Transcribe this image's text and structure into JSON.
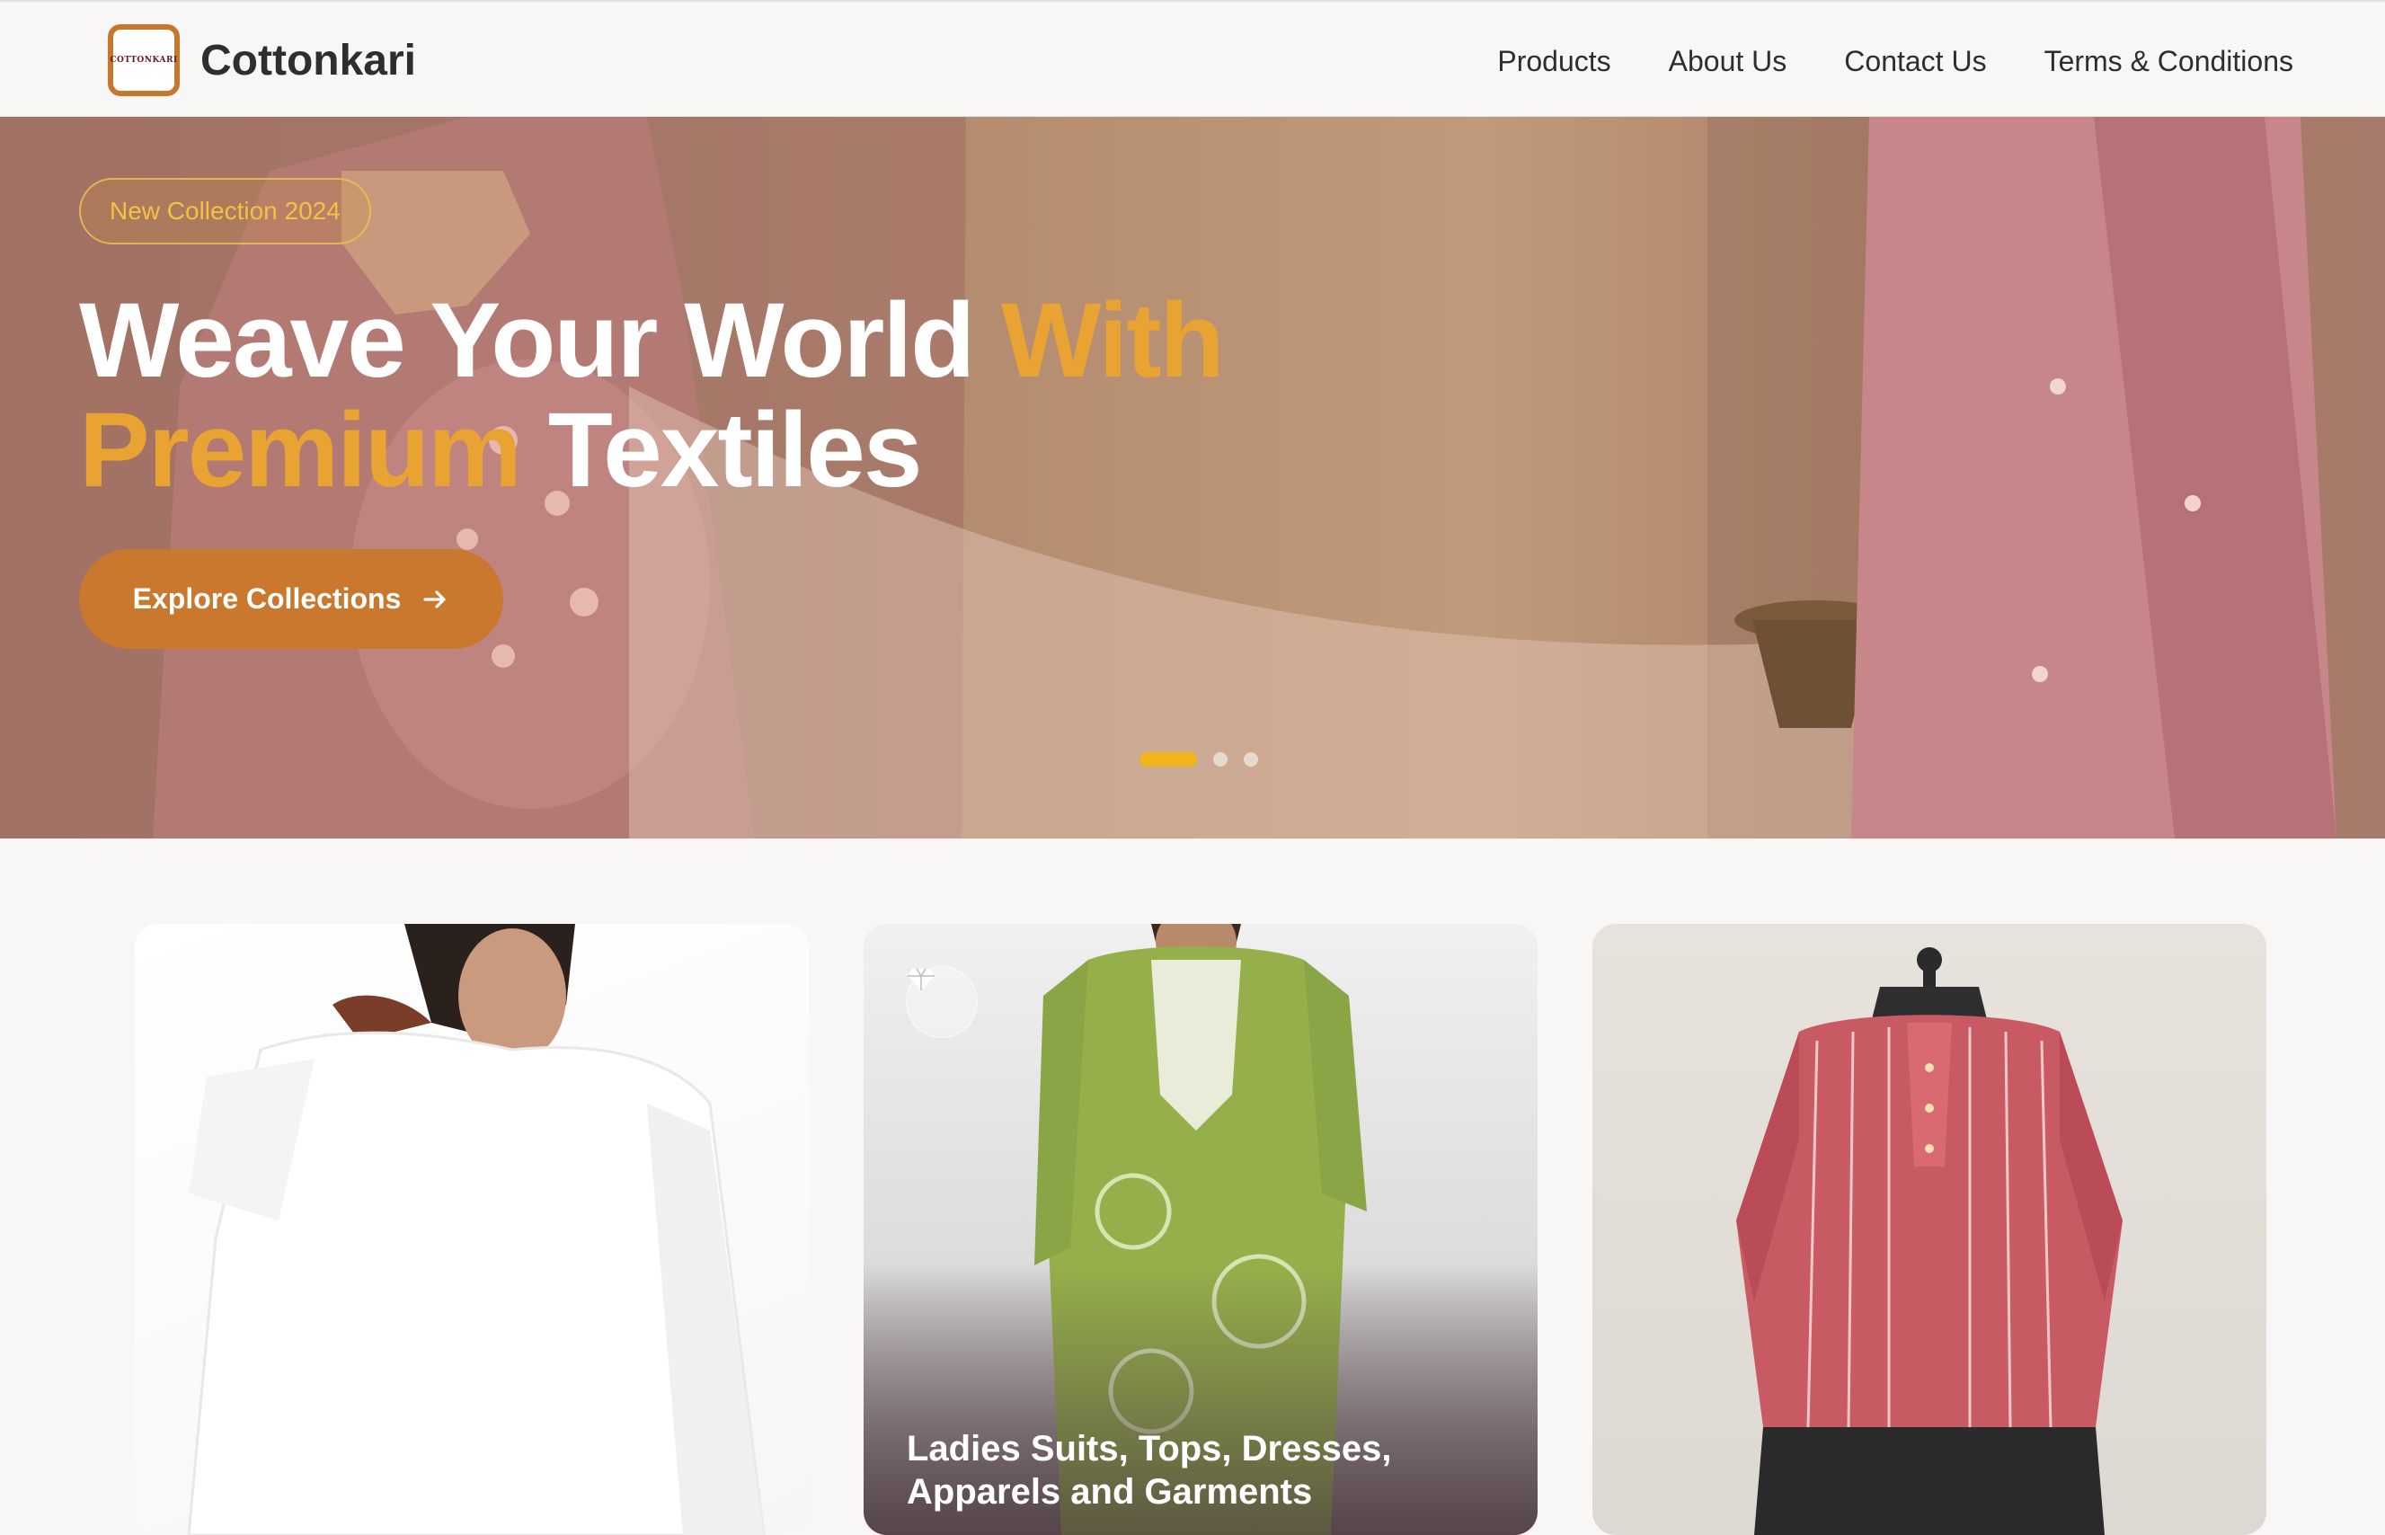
{
  "header": {
    "brand": "Cottonkari",
    "logo_text": "COTTONKARI",
    "nav": [
      "Products",
      "About Us",
      "Contact Us",
      "Terms & Conditions"
    ]
  },
  "hero": {
    "badge": "New Collection 2024",
    "title_part1": "Weave Your World ",
    "title_accent1": "With",
    "title_accent2": "Premium",
    "title_part2": " Textiles",
    "cta_label": "Explore Collections",
    "cta_icon": "arrow-right-icon",
    "carousel_slides": 3,
    "carousel_active": 1
  },
  "cards": [
    {
      "name": "white-top-card",
      "caption": ""
    },
    {
      "name": "green-kurta-card",
      "icon": "gem-icon",
      "caption": "Ladies Suits, Tops, Dresses, Apparels and Garments"
    },
    {
      "name": "red-top-card",
      "caption": ""
    }
  ],
  "colors": {
    "accent": "#c9782e",
    "highlight": "#e9a333",
    "badge_text": "#f5c046",
    "active_dot": "#f3b51c"
  }
}
